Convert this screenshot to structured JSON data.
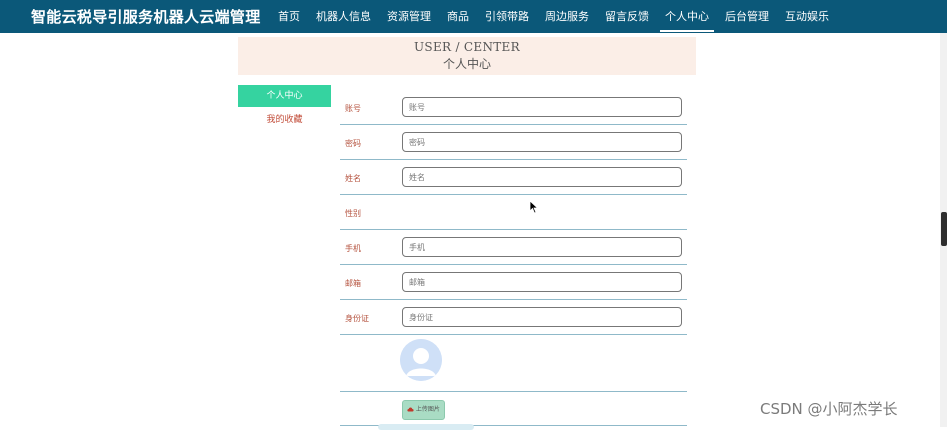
{
  "header": {
    "site_title": "智能云税导引服务机器人云端管理",
    "nav": [
      "首页",
      "机器人信息",
      "资源管理",
      "商品",
      "引领带路",
      "周边服务",
      "留言反馈",
      "个人中心",
      "后台管理",
      "互动娱乐"
    ],
    "active_nav": "个人中心"
  },
  "banner": {
    "en": "USER / CENTER",
    "cn": "个人中心"
  },
  "side_menu": {
    "items": [
      "个人中心",
      "我的收藏"
    ],
    "active": "个人中心"
  },
  "form": {
    "fields": [
      {
        "label": "账号",
        "placeholder": "账号"
      },
      {
        "label": "密码",
        "placeholder": "密码"
      },
      {
        "label": "姓名",
        "placeholder": "姓名"
      },
      {
        "label": "性别"
      },
      {
        "label": "手机",
        "placeholder": "手机"
      },
      {
        "label": "邮箱",
        "placeholder": "邮箱"
      },
      {
        "label": "身份证",
        "placeholder": "身份证"
      }
    ],
    "upload_label": "上传图片"
  },
  "watermark": "CSDN @小阿杰学长",
  "colors": {
    "topbar": "#0b5879",
    "accent": "#35d3a0",
    "banner_bg": "#fbeee7",
    "label": "#b5533f"
  },
  "icons": {
    "upload": "cloud-upload-icon",
    "avatar": "user-avatar-icon",
    "cursor": "mouse-cursor-icon"
  }
}
